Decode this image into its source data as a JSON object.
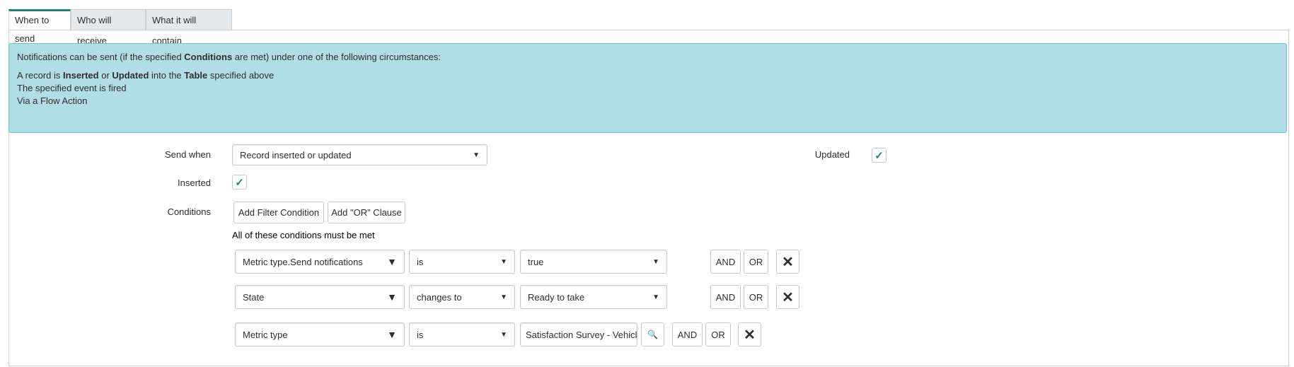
{
  "tabs": [
    {
      "label": "When to send"
    },
    {
      "label": "Who will receive"
    },
    {
      "label": "What it will contain"
    }
  ],
  "info": {
    "intro_pre": "Notifications can be sent (if the specified ",
    "intro_bold": "Conditions",
    "intro_post": " are met) under one of the following circumstances:",
    "l1_a": "A record is ",
    "l1_b": "Inserted",
    "l1_c": " or ",
    "l1_d": "Updated",
    "l1_e": " into the ",
    "l1_f": "Table",
    "l1_g": " specified above",
    "l2": "The specified event is fired",
    "l3": "Via a Flow Action"
  },
  "form": {
    "send_when_label": "Send when",
    "send_when_value": "Record inserted or updated",
    "updated_label": "Updated",
    "updated_checked": true,
    "inserted_label": "Inserted",
    "inserted_checked": true,
    "conditions_label": "Conditions",
    "add_filter": "Add Filter Condition",
    "add_or": "Add \"OR\" Clause",
    "all_conditions": "All of these conditions must be met",
    "check_glyph": "✓",
    "caret": "▼",
    "x_glyph": "✕",
    "search_glyph": "🔍",
    "and": "AND",
    "or": "OR",
    "rows": [
      {
        "field": "Metric type.Send notifications",
        "op": "is",
        "value": "true"
      },
      {
        "field": "State",
        "op": "changes to",
        "value": "Ready to take"
      },
      {
        "field": "Metric type",
        "op": "is",
        "value": "Satisfaction Survey - Vehicl"
      }
    ]
  }
}
